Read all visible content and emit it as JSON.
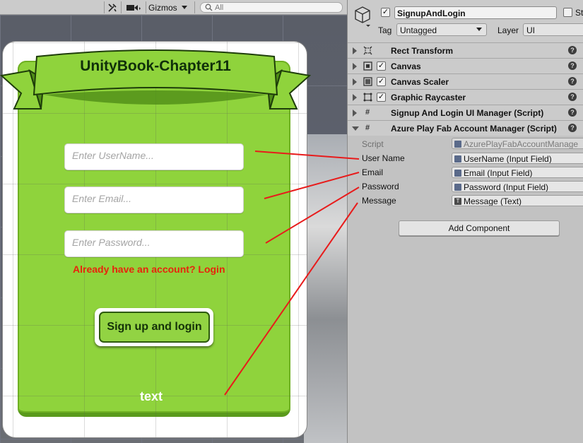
{
  "scene": {
    "toolbar": {
      "tools_icon": "tools-icon",
      "camera_icon": "camera-icon",
      "gizmos_label": "Gizmos",
      "search_placeholder": "All"
    },
    "canvas": {
      "title": "UnityBook-Chapter11",
      "username_placeholder": "Enter UserName...",
      "email_placeholder": "Enter Email...",
      "password_placeholder": "Enter Password...",
      "login_link": "Already have an account? Login",
      "signup_button": "Sign up and login",
      "message_text": "text",
      "card_color": "#8fd33c",
      "link_color": "#e8230c"
    }
  },
  "inspector": {
    "object_name": "SignupAndLogin",
    "object_active": true,
    "static_label": "St",
    "tag_label": "Tag",
    "tag_value": "Untagged",
    "layer_label": "Layer",
    "layer_value": "UI",
    "components": [
      {
        "name": "Rect Transform",
        "icon": "rect-transform-icon",
        "has_checkbox": false,
        "expanded": false
      },
      {
        "name": "Canvas",
        "icon": "canvas-icon",
        "has_checkbox": true,
        "expanded": false
      },
      {
        "name": "Canvas Scaler",
        "icon": "canvas-scaler-icon",
        "has_checkbox": true,
        "expanded": false
      },
      {
        "name": "Graphic Raycaster",
        "icon": "raycaster-icon",
        "has_checkbox": true,
        "expanded": false
      },
      {
        "name": "Signup And Login UI Manager (Script)",
        "icon": "script-icon",
        "has_checkbox": false,
        "expanded": false
      },
      {
        "name": "Azure Play Fab Account Manager (Script)",
        "icon": "script-icon",
        "has_checkbox": false,
        "expanded": true
      }
    ],
    "script_fields": {
      "script_label": "Script",
      "script_value": "AzurePlayFabAccountManage",
      "username_label": "User Name",
      "username_value": "UserName (Input Field)",
      "email_label": "Email",
      "email_value": "Email (Input Field)",
      "password_label": "Password",
      "password_value": "Password (Input Field)",
      "message_label": "Message",
      "message_value": "Message (Text)"
    },
    "add_component": "Add Component",
    "annotation_color": "#e81b1b"
  }
}
